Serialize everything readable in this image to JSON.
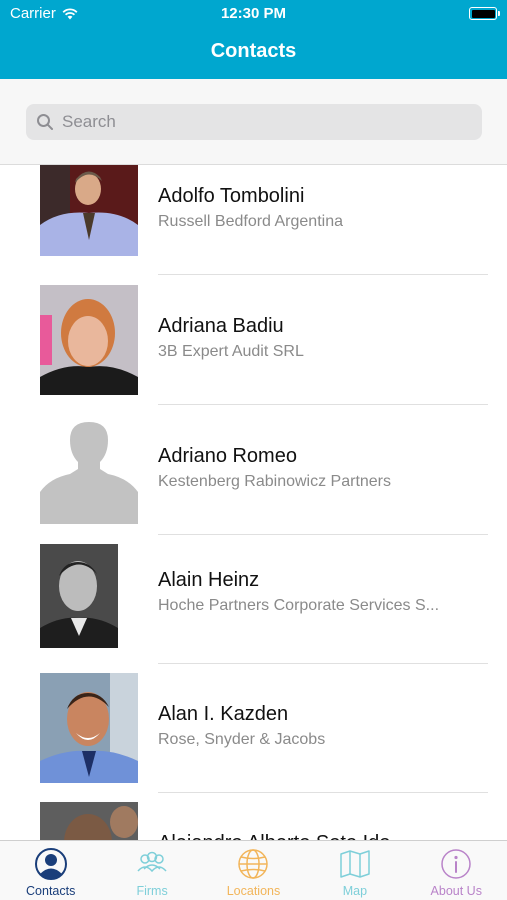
{
  "status_bar": {
    "carrier": "Carrier",
    "time": "12:30 PM"
  },
  "nav": {
    "title": "Contacts"
  },
  "search": {
    "placeholder": "Search"
  },
  "contacts": [
    {
      "name": "Adolfo Tombolini",
      "company": "Russell Bedford Argentina"
    },
    {
      "name": "Adriana Badiu",
      "company": "3B Expert Audit SRL"
    },
    {
      "name": "Adriano Romeo",
      "company": "Kestenberg Rabinowicz Partners"
    },
    {
      "name": "Alain Heinz",
      "company": "Hoche Partners Corporate Services S..."
    },
    {
      "name": "Alan I. Kazden",
      "company": "Rose, Snyder & Jacobs"
    },
    {
      "name": "Alejandro Alberto Soto Ido",
      "company": ""
    }
  ],
  "tabs": [
    {
      "label": "Contacts",
      "icon": "person-circle-icon",
      "color": "#1a3e7a",
      "selected": true
    },
    {
      "label": "Firms",
      "icon": "people-group-icon",
      "color": "#7ecfd9"
    },
    {
      "label": "Locations",
      "icon": "globe-icon",
      "color": "#f2b55a"
    },
    {
      "label": "Map",
      "icon": "map-icon",
      "color": "#7ecfd9"
    },
    {
      "label": "About Us",
      "icon": "info-circle-icon",
      "color": "#b983c9"
    }
  ],
  "colors": {
    "header": "#00a7cf",
    "header_text": "#ffffff",
    "name_text": "#111111",
    "company_text": "#8a8a8a"
  }
}
